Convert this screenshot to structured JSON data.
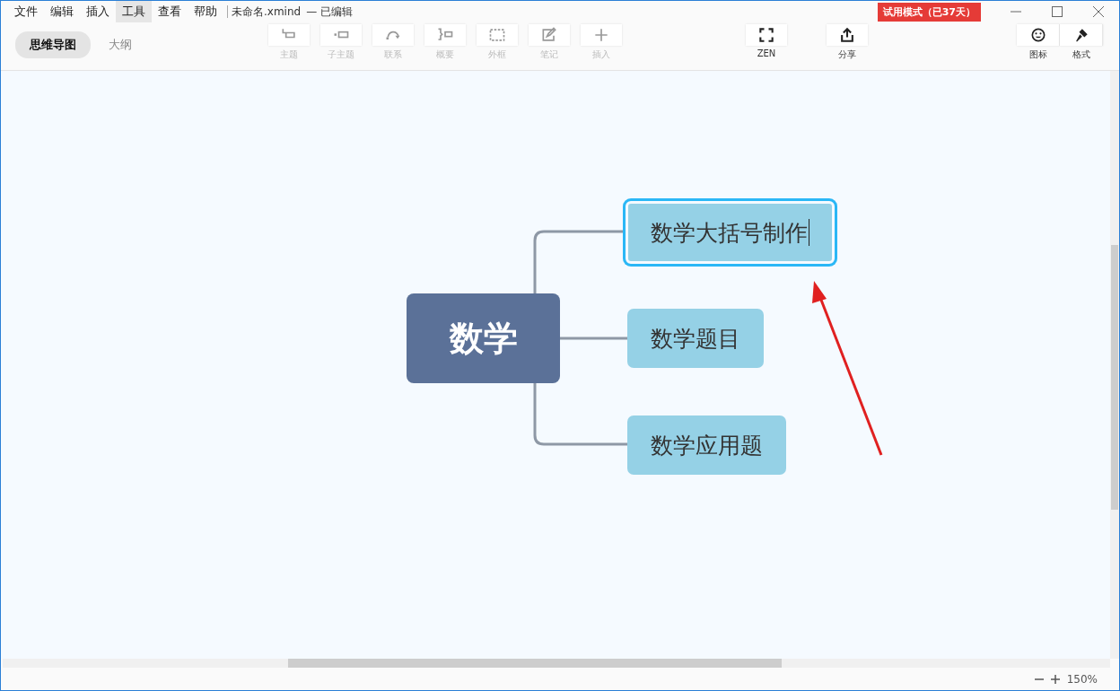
{
  "menu": [
    {
      "label": "文件",
      "selected": false
    },
    {
      "label": "编辑",
      "selected": false
    },
    {
      "label": "插入",
      "selected": false
    },
    {
      "label": "工具",
      "selected": true
    },
    {
      "label": "查看",
      "selected": false
    },
    {
      "label": "帮助",
      "selected": false
    }
  ],
  "document": {
    "name": "未命名.xmind",
    "status": "— 已编辑"
  },
  "trial_badge": "试用模式（已37天）",
  "view_tabs": [
    {
      "label": "思维导图",
      "selected": true
    },
    {
      "label": "大纲",
      "selected": false
    }
  ],
  "tools": [
    {
      "kind": "topic",
      "label": "主题",
      "disabled": true
    },
    {
      "kind": "subtopic",
      "label": "子主题",
      "disabled": true
    },
    {
      "kind": "relation",
      "label": "联系",
      "disabled": true
    },
    {
      "kind": "summary",
      "label": "概要",
      "disabled": true
    },
    {
      "kind": "boundary",
      "label": "外框",
      "disabled": true
    },
    {
      "kind": "note",
      "label": "笔记",
      "disabled": true
    },
    {
      "kind": "insert",
      "label": "插入",
      "disabled": true
    }
  ],
  "actions": [
    {
      "kind": "zen",
      "label": "ZEN"
    },
    {
      "kind": "share",
      "label": "分享"
    }
  ],
  "panels": [
    {
      "kind": "icon",
      "label": "图标"
    },
    {
      "kind": "format",
      "label": "格式"
    }
  ],
  "map": {
    "central": "数学",
    "topics": [
      {
        "text": "数学大括号制作",
        "selected": true,
        "editing": true
      },
      {
        "text": "数学题目",
        "selected": false,
        "editing": false
      },
      {
        "text": "数学应用题",
        "selected": false,
        "editing": false
      }
    ]
  },
  "status_bar": {
    "zoom": "150%"
  }
}
